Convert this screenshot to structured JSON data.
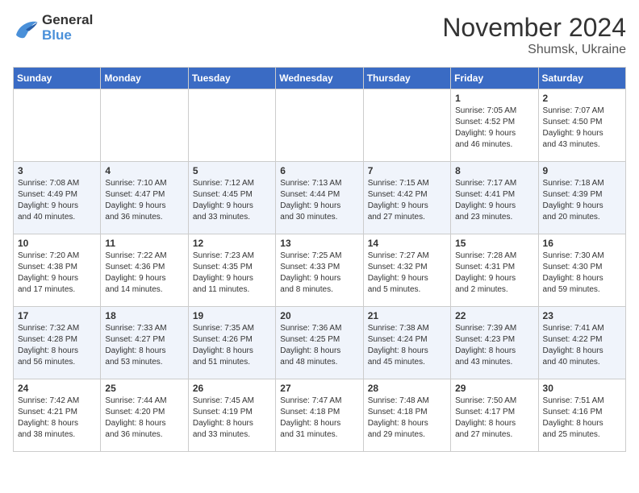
{
  "header": {
    "logo_line1": "General",
    "logo_line2": "Blue",
    "title": "November 2024",
    "subtitle": "Shumsk, Ukraine"
  },
  "days_of_week": [
    "Sunday",
    "Monday",
    "Tuesday",
    "Wednesday",
    "Thursday",
    "Friday",
    "Saturday"
  ],
  "weeks": [
    [
      {
        "day": "",
        "info": ""
      },
      {
        "day": "",
        "info": ""
      },
      {
        "day": "",
        "info": ""
      },
      {
        "day": "",
        "info": ""
      },
      {
        "day": "",
        "info": ""
      },
      {
        "day": "1",
        "info": "Sunrise: 7:05 AM\nSunset: 4:52 PM\nDaylight: 9 hours\nand 46 minutes."
      },
      {
        "day": "2",
        "info": "Sunrise: 7:07 AM\nSunset: 4:50 PM\nDaylight: 9 hours\nand 43 minutes."
      }
    ],
    [
      {
        "day": "3",
        "info": "Sunrise: 7:08 AM\nSunset: 4:49 PM\nDaylight: 9 hours\nand 40 minutes."
      },
      {
        "day": "4",
        "info": "Sunrise: 7:10 AM\nSunset: 4:47 PM\nDaylight: 9 hours\nand 36 minutes."
      },
      {
        "day": "5",
        "info": "Sunrise: 7:12 AM\nSunset: 4:45 PM\nDaylight: 9 hours\nand 33 minutes."
      },
      {
        "day": "6",
        "info": "Sunrise: 7:13 AM\nSunset: 4:44 PM\nDaylight: 9 hours\nand 30 minutes."
      },
      {
        "day": "7",
        "info": "Sunrise: 7:15 AM\nSunset: 4:42 PM\nDaylight: 9 hours\nand 27 minutes."
      },
      {
        "day": "8",
        "info": "Sunrise: 7:17 AM\nSunset: 4:41 PM\nDaylight: 9 hours\nand 23 minutes."
      },
      {
        "day": "9",
        "info": "Sunrise: 7:18 AM\nSunset: 4:39 PM\nDaylight: 9 hours\nand 20 minutes."
      }
    ],
    [
      {
        "day": "10",
        "info": "Sunrise: 7:20 AM\nSunset: 4:38 PM\nDaylight: 9 hours\nand 17 minutes."
      },
      {
        "day": "11",
        "info": "Sunrise: 7:22 AM\nSunset: 4:36 PM\nDaylight: 9 hours\nand 14 minutes."
      },
      {
        "day": "12",
        "info": "Sunrise: 7:23 AM\nSunset: 4:35 PM\nDaylight: 9 hours\nand 11 minutes."
      },
      {
        "day": "13",
        "info": "Sunrise: 7:25 AM\nSunset: 4:33 PM\nDaylight: 9 hours\nand 8 minutes."
      },
      {
        "day": "14",
        "info": "Sunrise: 7:27 AM\nSunset: 4:32 PM\nDaylight: 9 hours\nand 5 minutes."
      },
      {
        "day": "15",
        "info": "Sunrise: 7:28 AM\nSunset: 4:31 PM\nDaylight: 9 hours\nand 2 minutes."
      },
      {
        "day": "16",
        "info": "Sunrise: 7:30 AM\nSunset: 4:30 PM\nDaylight: 8 hours\nand 59 minutes."
      }
    ],
    [
      {
        "day": "17",
        "info": "Sunrise: 7:32 AM\nSunset: 4:28 PM\nDaylight: 8 hours\nand 56 minutes."
      },
      {
        "day": "18",
        "info": "Sunrise: 7:33 AM\nSunset: 4:27 PM\nDaylight: 8 hours\nand 53 minutes."
      },
      {
        "day": "19",
        "info": "Sunrise: 7:35 AM\nSunset: 4:26 PM\nDaylight: 8 hours\nand 51 minutes."
      },
      {
        "day": "20",
        "info": "Sunrise: 7:36 AM\nSunset: 4:25 PM\nDaylight: 8 hours\nand 48 minutes."
      },
      {
        "day": "21",
        "info": "Sunrise: 7:38 AM\nSunset: 4:24 PM\nDaylight: 8 hours\nand 45 minutes."
      },
      {
        "day": "22",
        "info": "Sunrise: 7:39 AM\nSunset: 4:23 PM\nDaylight: 8 hours\nand 43 minutes."
      },
      {
        "day": "23",
        "info": "Sunrise: 7:41 AM\nSunset: 4:22 PM\nDaylight: 8 hours\nand 40 minutes."
      }
    ],
    [
      {
        "day": "24",
        "info": "Sunrise: 7:42 AM\nSunset: 4:21 PM\nDaylight: 8 hours\nand 38 minutes."
      },
      {
        "day": "25",
        "info": "Sunrise: 7:44 AM\nSunset: 4:20 PM\nDaylight: 8 hours\nand 36 minutes."
      },
      {
        "day": "26",
        "info": "Sunrise: 7:45 AM\nSunset: 4:19 PM\nDaylight: 8 hours\nand 33 minutes."
      },
      {
        "day": "27",
        "info": "Sunrise: 7:47 AM\nSunset: 4:18 PM\nDaylight: 8 hours\nand 31 minutes."
      },
      {
        "day": "28",
        "info": "Sunrise: 7:48 AM\nSunset: 4:18 PM\nDaylight: 8 hours\nand 29 minutes."
      },
      {
        "day": "29",
        "info": "Sunrise: 7:50 AM\nSunset: 4:17 PM\nDaylight: 8 hours\nand 27 minutes."
      },
      {
        "day": "30",
        "info": "Sunrise: 7:51 AM\nSunset: 4:16 PM\nDaylight: 8 hours\nand 25 minutes."
      }
    ]
  ]
}
